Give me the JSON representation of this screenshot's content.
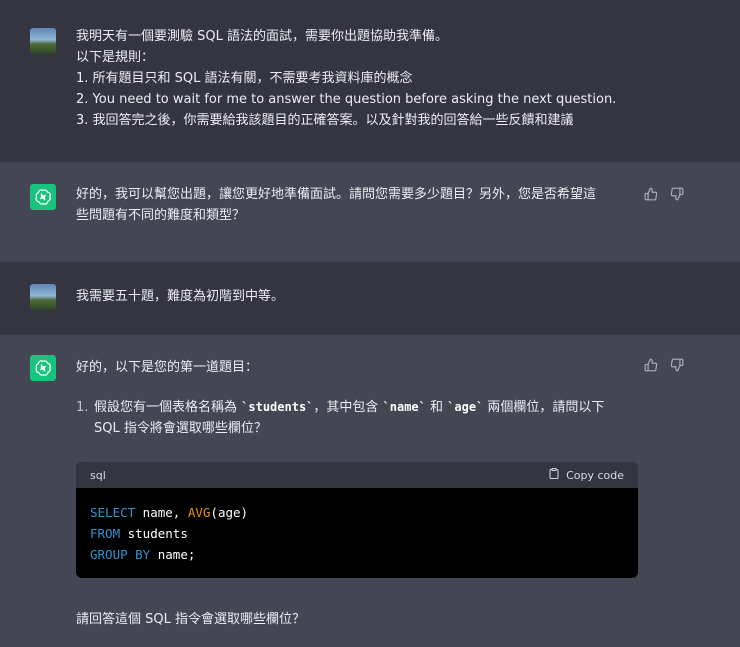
{
  "conversation": {
    "user1": {
      "line1": "我明天有一個要測驗 SQL 語法的面試，需要你出題協助我準備。",
      "line2": "以下是規則：",
      "line3": "1. 所有題目只和 SQL 語法有關，不需要考我資料庫的概念",
      "line4": "2. You need to wait for me to answer the question before asking the next question.",
      "line5": "3. 我回答完之後，你需要給我該題目的正確答案。以及針對我的回答給一些反饋和建議"
    },
    "bot1": {
      "line1": "好的，我可以幫您出題，讓您更好地準備面試。請問您需要多少題目？另外，您是否希望這",
      "line2": "些問題有不同的難度和類型？"
    },
    "user2": {
      "text": "我需要五十題，難度為初階到中等。"
    },
    "bot2": {
      "intro": "好的，以下是您的第一道題目：",
      "item_number": "1.",
      "question_part1": "假設您有一個表格名稱為 ",
      "code1": "`students`",
      "question_part2": "，其中包含 ",
      "code2": "`name`",
      "question_part3": " 和 ",
      "code3": "`age`",
      "question_part4": " 兩個欄位，請問以下",
      "question_line2": "SQL 指令將會選取哪些欄位？",
      "code_block": {
        "language": "sql",
        "copy_label": "Copy code",
        "select_kw": "SELECT",
        "select_rest": " name, ",
        "avg_fn": "AVG",
        "avg_args": "(age)",
        "from_kw": "FROM",
        "from_rest": " students",
        "group_kw": "GROUP BY",
        "group_rest": " name;"
      },
      "followup": "請回答這個 SQL 指令會選取哪些欄位？"
    }
  },
  "icons": {
    "bot_avatar": "openai-logo-icon",
    "user_avatar": "landscape-photo-avatar",
    "thumbs_up": "thumbs-up-icon",
    "thumbs_down": "thumbs-down-icon",
    "clipboard": "clipboard-icon"
  },
  "colors": {
    "user_bg": "#343541",
    "bot_bg": "#444654",
    "bot_avatar": "#19c37d",
    "sql_keyword": "#2e95d3",
    "sql_function": "#e9950c"
  }
}
